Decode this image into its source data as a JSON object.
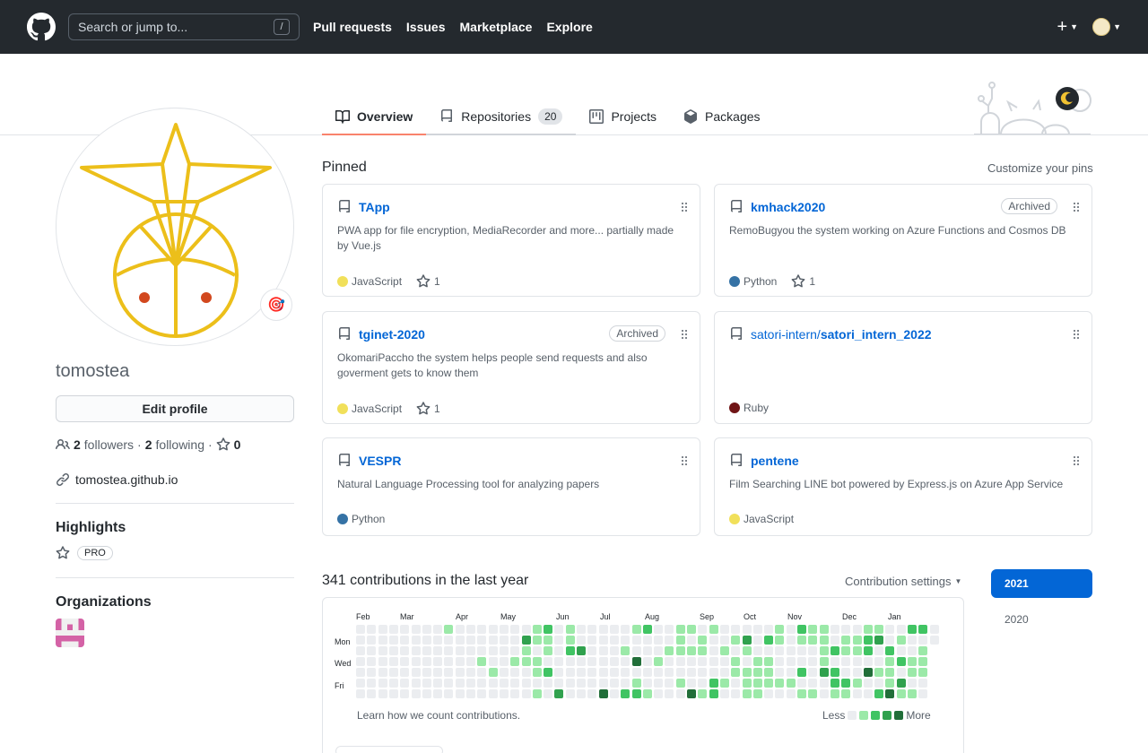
{
  "header": {
    "search_placeholder": "Search or jump to...",
    "slash_hint": "/",
    "nav": [
      "Pull requests",
      "Issues",
      "Marketplace",
      "Explore"
    ]
  },
  "tabs": [
    {
      "label": "Overview",
      "icon": "book-icon",
      "selected": true
    },
    {
      "label": "Repositories",
      "icon": "repo-icon",
      "count": "20"
    },
    {
      "label": "Projects",
      "icon": "project-icon"
    },
    {
      "label": "Packages",
      "icon": "package-icon"
    }
  ],
  "profile": {
    "username": "tomostea",
    "edit_label": "Edit profile",
    "followers_count": "2",
    "followers_label": "followers",
    "separator": "·",
    "following_count": "2",
    "following_label": "following",
    "stars_count": "0",
    "website": "tomostea.github.io",
    "status_emoji": "🎯"
  },
  "highlights": {
    "title": "Highlights",
    "badge": "PRO"
  },
  "organizations": {
    "title": "Organizations"
  },
  "pinned": {
    "title": "Pinned",
    "customize_label": "Customize your pins",
    "cards": [
      {
        "owner": "",
        "name": "TApp",
        "desc": "PWA app for file encryption, MediaRecorder and more... partially made by Vue.js",
        "lang": "JavaScript",
        "lang_color": "#f1e05a",
        "stars": "1",
        "archived": ""
      },
      {
        "owner": "",
        "name": "kmhack2020",
        "desc": "RemoBugyou the system working on Azure Functions and Cosmos DB",
        "lang": "Python",
        "lang_color": "#3572A5",
        "stars": "1",
        "archived": "Archived"
      },
      {
        "owner": "",
        "name": "tginet-2020",
        "desc": "OkomariPaccho the system helps people send requests and also goverment gets to know them",
        "lang": "JavaScript",
        "lang_color": "#f1e05a",
        "stars": "1",
        "archived": "Archived"
      },
      {
        "owner": "satori-intern/",
        "name": "satori_intern_2022",
        "desc": "",
        "lang": "Ruby",
        "lang_color": "#701516",
        "stars": "",
        "archived": ""
      },
      {
        "owner": "",
        "name": "VESPR",
        "desc": "Natural Language Processing tool for analyzing papers",
        "lang": "Python",
        "lang_color": "#3572A5",
        "stars": "",
        "archived": ""
      },
      {
        "owner": "",
        "name": "pentene",
        "desc": "Film Searching LINE bot powered by Express.js on Azure App Service",
        "lang": "JavaScript",
        "lang_color": "#f1e05a",
        "stars": "",
        "archived": ""
      }
    ]
  },
  "contributions": {
    "title": "341 contributions in the last year",
    "settings_label": "Contribution settings",
    "months": [
      "Feb",
      "Mar",
      "Apr",
      "May",
      "Jun",
      "Jul",
      "Aug",
      "Sep",
      "Oct",
      "Nov",
      "Dec",
      "Jan"
    ],
    "weekdays": [
      "Mon",
      "Wed",
      "Fri"
    ],
    "learn_label": "Learn how we count contributions.",
    "less_label": "Less",
    "more_label": "More",
    "colors": [
      "#ebedf0",
      "#9be9a8",
      "#40c463",
      "#30a14e",
      "#216e39"
    ]
  },
  "years": [
    "2021",
    "2020"
  ]
}
